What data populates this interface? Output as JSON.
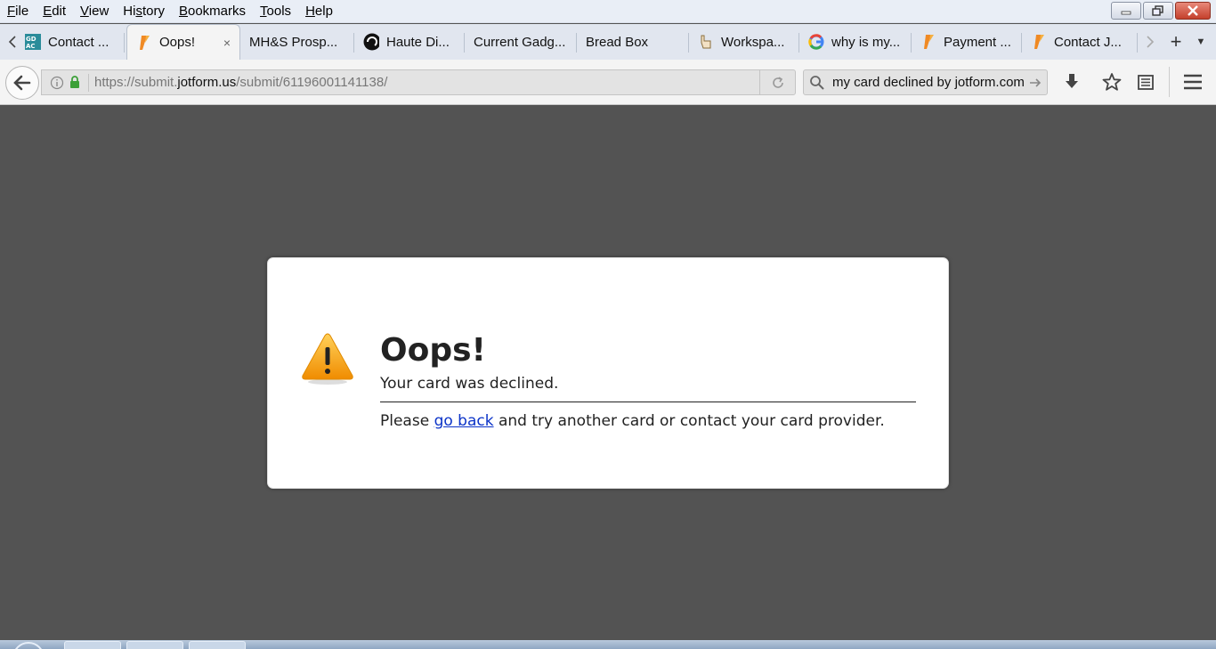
{
  "menubar": {
    "items": [
      "File",
      "Edit",
      "View",
      "History",
      "Bookmarks",
      "Tools",
      "Help"
    ],
    "accel": [
      "F",
      "E",
      "V",
      "s",
      "B",
      "T",
      "H"
    ]
  },
  "tabs": [
    {
      "title": "Contact ...",
      "favicon": "gdac-icon"
    },
    {
      "title": "Oops!",
      "favicon": "jotform-icon",
      "active": true,
      "close": "×"
    },
    {
      "title": "MH&S Prosp...",
      "favicon": ""
    },
    {
      "title": "Haute Di...",
      "favicon": "haute-icon"
    },
    {
      "title": "Current Gadg...",
      "favicon": ""
    },
    {
      "title": "Bread Box",
      "favicon": ""
    },
    {
      "title": "Workspa...",
      "favicon": "workspace-icon"
    },
    {
      "title": "why is my...",
      "favicon": "google-icon"
    },
    {
      "title": "Payment ...",
      "favicon": "jotform-icon"
    },
    {
      "title": "Contact J...",
      "favicon": "jotform-icon"
    }
  ],
  "tabstrip": {
    "new_tab": "+",
    "list": "▼"
  },
  "urlbar": {
    "scheme": "https://submit.",
    "host": "jotform.us",
    "path": "/submit/61196001141138/"
  },
  "searchbar": {
    "value": "my card declined by jotform.com"
  },
  "page": {
    "title": "Oops!",
    "subtitle": "Your card was declined.",
    "body_before": "Please ",
    "link": "go back",
    "body_after": " and try another card or contact your card provider."
  },
  "colors": {
    "page_bg": "#535353",
    "link": "#0b33c8",
    "warning_orange": "#f5a623"
  }
}
